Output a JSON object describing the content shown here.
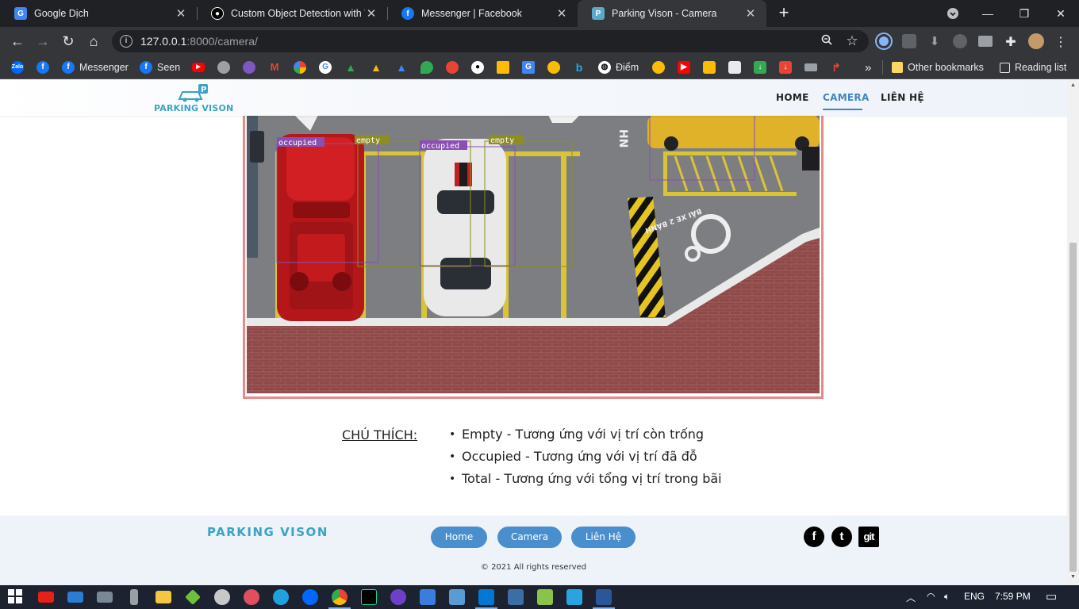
{
  "browser": {
    "tabs": [
      {
        "title": "Google Dịch",
        "active": false,
        "favicon": "google-translate-icon"
      },
      {
        "title": "Custom Object Detection with YC",
        "active": false,
        "favicon": "medium-icon"
      },
      {
        "title": "Messenger | Facebook",
        "active": false,
        "favicon": "facebook-icon"
      },
      {
        "title": "Parking Vison - Camera",
        "active": true,
        "favicon": "parking-vison-icon"
      }
    ],
    "new_tab": "+",
    "url": {
      "host": "127.0.0.1",
      "path": ":8000/camera/"
    },
    "bookmarks": {
      "messenger": "Messenger",
      "seen": "Seen",
      "diem": "Điểm",
      "more": "»",
      "other": "Other bookmarks",
      "reading_list": "Reading list"
    }
  },
  "site": {
    "logo_text": "PARKING VISON",
    "nav": {
      "home": "HOME",
      "camera": "CAMERA",
      "contact": "LIÊN HỆ",
      "active": "camera"
    },
    "camera": {
      "labels": {
        "occupied_1": "occupied",
        "empty_1": "empty",
        "occupied_2": "occupied",
        "empty_2": "empty"
      },
      "floor_text": "BÃI XE 2 BÁNH",
      "lane_text": "HN"
    },
    "legend": {
      "title": "CHÚ THÍCH:",
      "items": [
        "Empty - Tương ứng với vị trí còn trống",
        "Occupied - Tương ứng với vị trí đã đỗ",
        "Total - Tương ứng với tổng vị trí trong bãi"
      ]
    },
    "footer": {
      "logo_text": "PARKING VISON",
      "buttons": {
        "home": "Home",
        "camera": "Camera",
        "contact": "Liên Hệ"
      },
      "social": {
        "facebook": "f",
        "twitter": "t",
        "git": "git"
      },
      "copyright": "© 2021 All rights reserved"
    }
  },
  "taskbar": {
    "language": "ENG",
    "time": "7:59 PM"
  },
  "colors": {
    "accent": "#3e86c4",
    "footer_button": "#4a8fcd",
    "logo": "#3aa3c6",
    "frame_border": "#e68a8a",
    "occupied_box": "#8a4fb0",
    "empty_box": "#8d8d20"
  }
}
